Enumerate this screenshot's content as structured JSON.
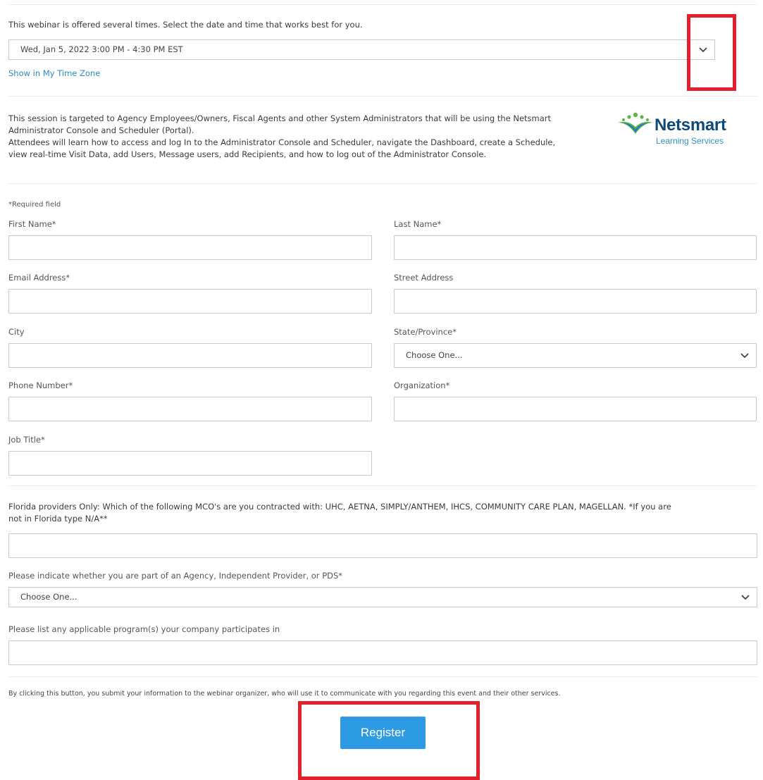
{
  "session": {
    "intro_text": "This webinar is offered several times. Select the date and time that works best for you.",
    "selected_datetime": "Wed, Jan 5, 2022 3:00 PM - 4:30 PM EST",
    "timezone_link": "Show in My Time Zone"
  },
  "description": {
    "line1": "This session is targeted to Agency Employees/Owners, Fiscal Agents and other System Administrators that will be using the Netsmart",
    "line2": "Administrator Console and Scheduler (Portal).",
    "line3": "Attendees will learn how to access and log In to the Administrator Console and Scheduler, navigate the Dashboard, create a Schedule,",
    "line4": "view real-time Visit Data, add Users, Message users, add Recipients, and how to log out of the Administrator Console."
  },
  "logo": {
    "brand": "Netsmart",
    "tagline": "Learning Services",
    "brand_color": "#0d4a7a",
    "accent_color": "#5fb34a",
    "tagline_color": "#2e8fc8"
  },
  "form": {
    "required_note": "*Required field",
    "first_name_label": "First Name*",
    "last_name_label": "Last Name*",
    "email_label": "Email Address*",
    "street_label": "Street Address",
    "city_label": "City",
    "state_label": "State/Province*",
    "state_value": "Choose One...",
    "phone_label": "Phone Number*",
    "organization_label": "Organization*",
    "job_title_label": "Job Title*",
    "mco_question_line1": "Florida providers Only: Which of the following MCO's are you contracted with: UHC, AETNA, SIMPLY/ANTHEM, IHCS, COMMUNITY CARE PLAN, MAGELLAN. *If you are",
    "mco_question_line2": "not in Florida type N/A**",
    "provider_type_label": "Please indicate whether you are part of an Agency, Independent Provider, or PDS*",
    "provider_type_value": "Choose One...",
    "programs_label": "Please list any applicable program(s) your company participates in"
  },
  "footer": {
    "disclaimer": "By clicking this button, you submit your information to the webinar organizer, who will use it to communicate with you regarding this event and their other services.",
    "register_label": "Register"
  },
  "colors": {
    "highlight": "#e3202e",
    "button": "#2c9be3",
    "link": "#2a8bc5"
  }
}
